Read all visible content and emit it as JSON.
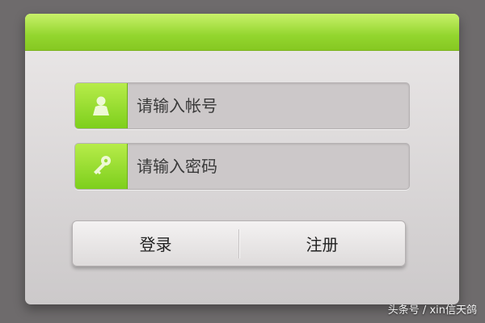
{
  "login_form": {
    "username": {
      "placeholder": "请输入帐号",
      "value": "",
      "icon": "user-icon"
    },
    "password": {
      "placeholder": "请输入密码",
      "value": "",
      "icon": "key-icon"
    },
    "login_label": "登录",
    "register_label": "注册"
  },
  "watermark": "头条号 / xin信天鸽",
  "colors": {
    "accent_green": "#8fd42a",
    "panel_bg": "#e6e3e3",
    "page_bg": "#6e6b6c"
  }
}
